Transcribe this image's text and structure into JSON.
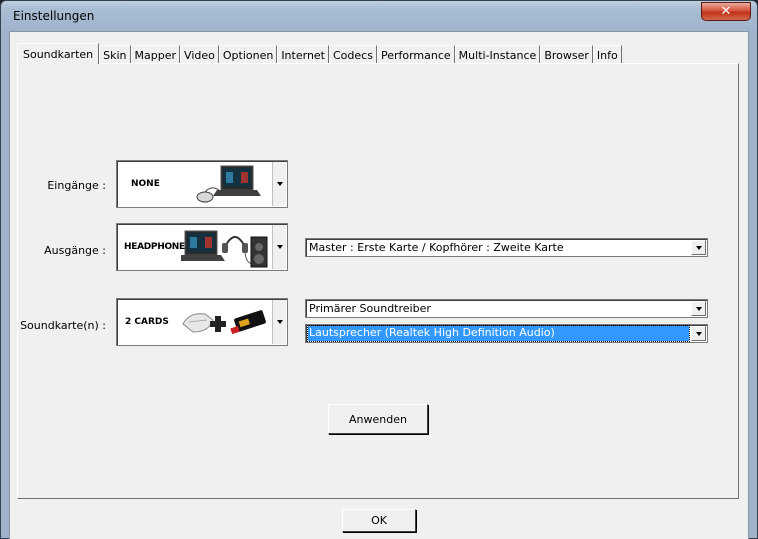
{
  "window": {
    "title": "Einstellungen",
    "close_glyph": "✕"
  },
  "tabs": [
    "Soundkarten",
    "Skin",
    "Mapper",
    "Video",
    "Optionen",
    "Internet",
    "Codecs",
    "Performance",
    "Multi-Instance",
    "Browser",
    "Info"
  ],
  "active_tab": "Soundkarten",
  "rows": {
    "inputs": {
      "label": "Eingänge :",
      "image_text": "NONE",
      "icon": "laptop-with-mouse-icon"
    },
    "outputs": {
      "label": "Ausgänge :",
      "image_text": "HEADPHONES",
      "icon": "laptop-headphones-speaker-icon",
      "select_value": "Master : Erste Karte / Kopfhörer : Zweite Karte"
    },
    "soundcard": {
      "label": "Soundkarte(n) :",
      "image_text": "2 CARDS",
      "icon": "two-soundcards-icon",
      "driver_value": "Primärer Soundtreiber",
      "device_value": "Lautsprecher (Realtek High Definition Audio)"
    }
  },
  "buttons": {
    "apply": "Anwenden",
    "ok": "OK"
  },
  "colors": {
    "selection": "#3399ff",
    "close": "#c1301a"
  }
}
